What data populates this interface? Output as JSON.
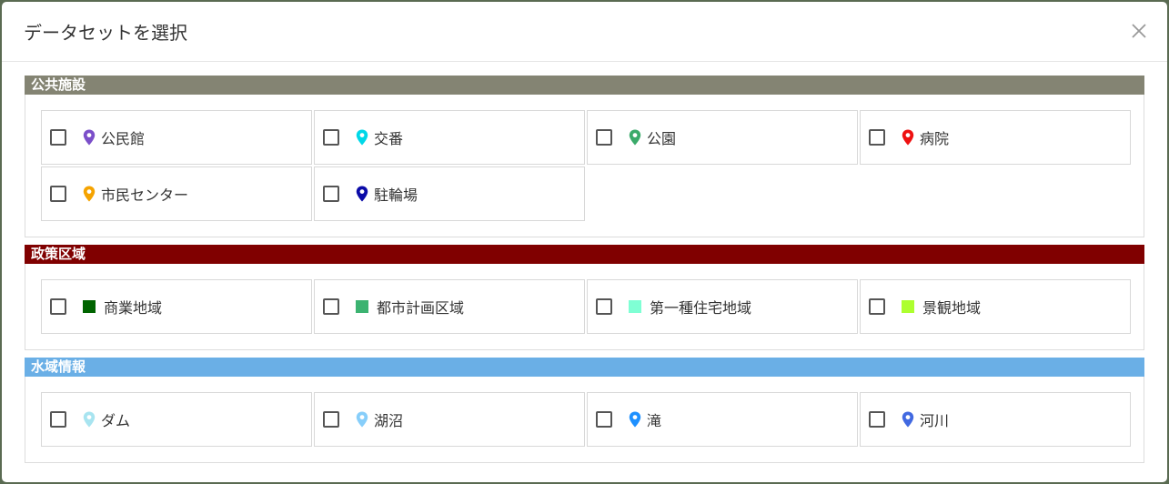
{
  "modal": {
    "title": "データセットを選択"
  },
  "sections": [
    {
      "title": "公共施設",
      "color": "#848473",
      "items": [
        {
          "label": "公民館",
          "icon": "pin-icon",
          "color": "#7b4fc9"
        },
        {
          "label": "交番",
          "icon": "pin-icon",
          "color": "#00d8e8"
        },
        {
          "label": "公園",
          "icon": "pin-icon",
          "color": "#3aaa6a"
        },
        {
          "label": "病院",
          "icon": "pin-icon",
          "color": "#ee1111"
        },
        {
          "label": "市民センター",
          "icon": "pin-icon",
          "color": "#f5a300"
        },
        {
          "label": "駐輪場",
          "icon": "pin-icon",
          "color": "#0b0ba8"
        }
      ]
    },
    {
      "title": "政策区域",
      "color": "#800000",
      "items": [
        {
          "label": "商業地域",
          "icon": "square-icon",
          "color": "#006400"
        },
        {
          "label": "都市計画区域",
          "icon": "square-icon",
          "color": "#3cb371"
        },
        {
          "label": "第一種住宅地域",
          "icon": "square-icon",
          "color": "#7fffd4"
        },
        {
          "label": "景観地域",
          "icon": "square-icon",
          "color": "#adff2f"
        }
      ]
    },
    {
      "title": "水域情報",
      "color": "#6aafe6",
      "items": [
        {
          "label": "ダム",
          "icon": "pin-icon",
          "color": "#a8e4f0"
        },
        {
          "label": "湖沼",
          "icon": "pin-icon",
          "color": "#87cefa"
        },
        {
          "label": "滝",
          "icon": "pin-icon",
          "color": "#1e90ff"
        },
        {
          "label": "河川",
          "icon": "pin-icon",
          "color": "#4169e1"
        }
      ]
    }
  ]
}
